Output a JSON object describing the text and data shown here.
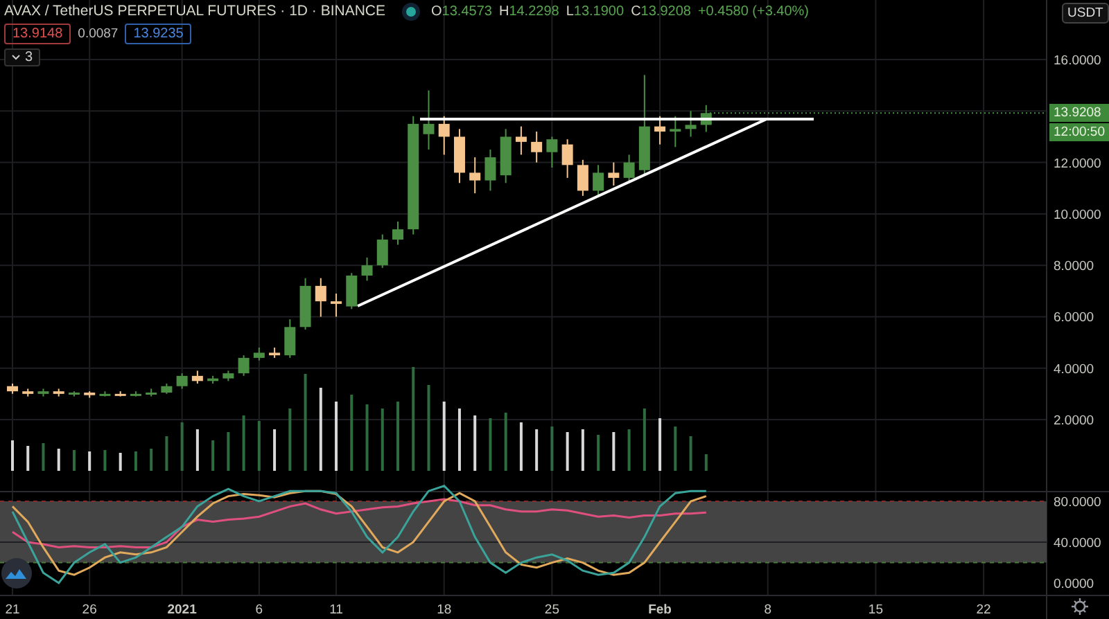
{
  "header": {
    "title": "AVAX / TetherUS PERPETUAL FUTURES · 1D · BINANCE",
    "ohlc": [
      {
        "label": "O",
        "value": "13.4573"
      },
      {
        "label": "H",
        "value": "14.2298"
      },
      {
        "label": "L",
        "value": "13.1900"
      },
      {
        "label": "C",
        "value": "13.9208"
      }
    ],
    "change": "+0.4580 (+3.40%)"
  },
  "quote": {
    "bid": "13.9148",
    "spread": "0.0087",
    "ask": "13.9235"
  },
  "indicators_toggle": {
    "count": "3",
    "expanded": false
  },
  "currency_button": "USDT",
  "price_axis": [
    "16.0000",
    "12.0000",
    "10.0000",
    "8.0000",
    "6.0000",
    "4.0000",
    "2.0000"
  ],
  "last_price": "13.9208",
  "countdown": "12:00:50",
  "oscillator_axis": [
    "80.0000",
    "40.0000",
    "0.0000"
  ],
  "time_axis": [
    "21",
    "26",
    "2021",
    "6",
    "11",
    "18",
    "25",
    "Feb",
    "8",
    "15",
    "22"
  ]
}
